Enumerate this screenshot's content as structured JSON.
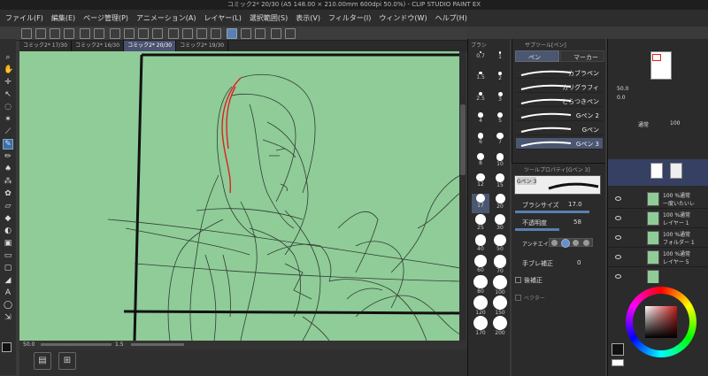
{
  "window": {
    "title": "コミック2* 20/30 (A5 148.00 × 210.00mm 600dpi 50.0%) - CLIP STUDIO PAINT EX"
  },
  "menu": [
    "ファイル(F)",
    "編集(E)",
    "ページ管理(P)",
    "アニメーション(A)",
    "レイヤー(L)",
    "選択範囲(S)",
    "表示(V)",
    "フィルター(I)",
    "ウィンドウ(W)",
    "ヘルプ(H)"
  ],
  "tabs": [
    {
      "label": "コミック2* 17/30",
      "active": false
    },
    {
      "label": "コミック2* 16/30",
      "active": false
    },
    {
      "label": "コミック2* 20/30",
      "active": true
    },
    {
      "label": "コミック2* 19/30",
      "active": false
    }
  ],
  "status": {
    "zoom": "50.0",
    "angle": "1.5"
  },
  "brush_panel": {
    "title": "ブラシ",
    "sizes": [
      "0.7",
      "1",
      "1.5",
      "2",
      "2.5",
      "3",
      "4",
      "5",
      "6",
      "7",
      "8",
      "10",
      "12",
      "15",
      "17",
      "20",
      "25",
      "30",
      "40",
      "50",
      "60",
      "70",
      "80",
      "100",
      "120",
      "150",
      "170",
      "200"
    ],
    "selected": "17"
  },
  "subtool": {
    "title": "サブツール[ペン]",
    "tabs": [
      "ペン",
      "マーカー"
    ],
    "brushes": [
      "カブラペン",
      "カリグラフィ",
      "とらつきペン",
      "Gペン 2",
      "Gペン",
      "Gペン 3"
    ],
    "selected_index": 5
  },
  "tool_property": {
    "title": "ツールプロパティ[Gペン 3]",
    "preview_label": "Gペン 3",
    "brush_size_label": "ブラシサイズ",
    "brush_size_value": "17.0",
    "opacity_label": "不透明度",
    "opacity_value": "58",
    "antialias_label": "アンチエイリアス",
    "hand_correction_label": "手ブレ補正",
    "hand_correction_value": "0",
    "post_correction_label": "後補正",
    "vector_label": "ベクター"
  },
  "layers": {
    "blend_mode": "通常",
    "opacity": "100",
    "items": [
      {
        "label": "100 %通常",
        "name": "一度いたいレ"
      },
      {
        "label": "100 %通常",
        "name": "レイヤー 1"
      },
      {
        "label": "100 %通常",
        "name": "フォルダー 1"
      },
      {
        "label": "100 %通常",
        "name": "レイヤー 5"
      },
      {
        "label": "",
        "name": ""
      }
    ]
  },
  "navigator": {
    "zoom": "50.0",
    "angle": "0.0"
  },
  "colors": {
    "accent": "#3b6ea8",
    "canvas": "#8fcc98",
    "red": "#e02020"
  }
}
